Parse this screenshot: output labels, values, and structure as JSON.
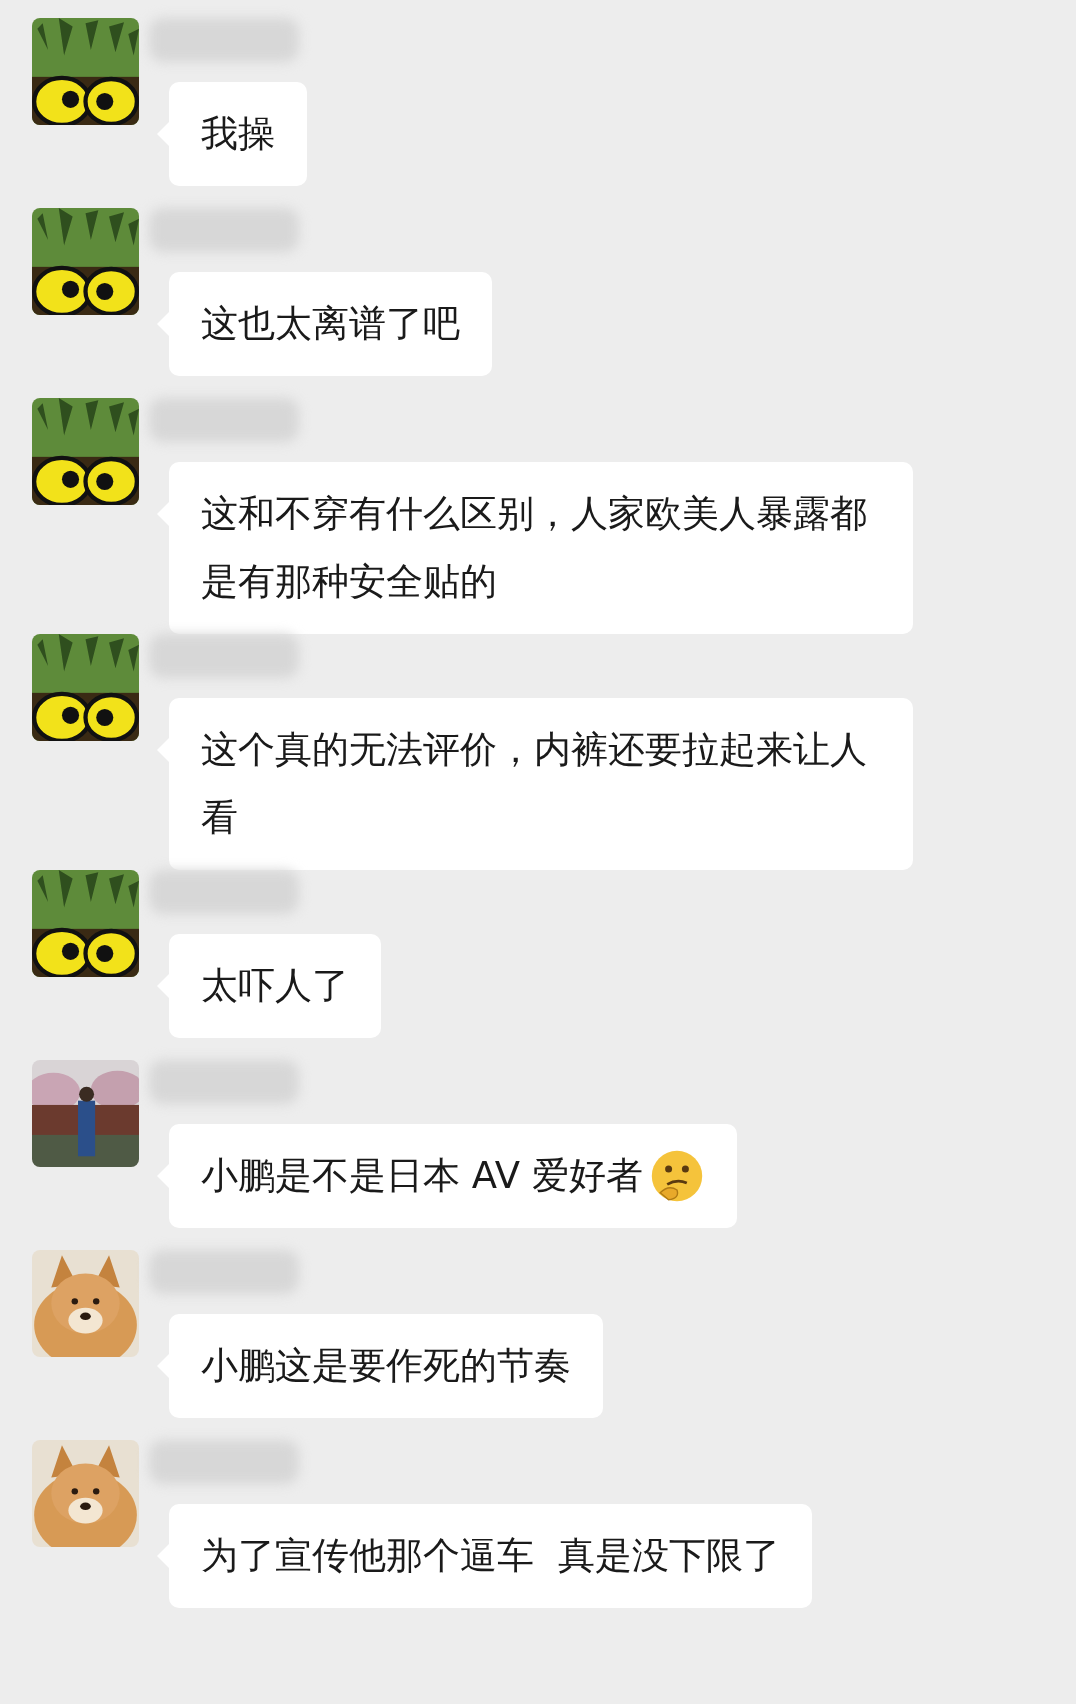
{
  "messages": [
    {
      "avatar": {
        "kind": "owl"
      },
      "text": "我操"
    },
    {
      "avatar": {
        "kind": "owl"
      },
      "text": "这也太离谱了吧"
    },
    {
      "avatar": {
        "kind": "owl"
      },
      "text": "这和不穿有什么区别，人家欧美人暴露都是有那种安全贴的"
    },
    {
      "avatar": {
        "kind": "owl"
      },
      "text": "这个真的无法评价，内裤还要拉起来让人看"
    },
    {
      "avatar": {
        "kind": "owl"
      },
      "text": "太吓人了"
    },
    {
      "avatar": {
        "kind": "person"
      },
      "text": "小鹏是不是日本 AV 爱好者",
      "emoji": {
        "kind": "thinking"
      }
    },
    {
      "avatar": {
        "kind": "dog"
      },
      "text": "小鹏这是要作死的节奏"
    },
    {
      "avatar": {
        "kind": "dog"
      },
      "text": "为了宣传他那个逼车  真是没下限了"
    }
  ]
}
